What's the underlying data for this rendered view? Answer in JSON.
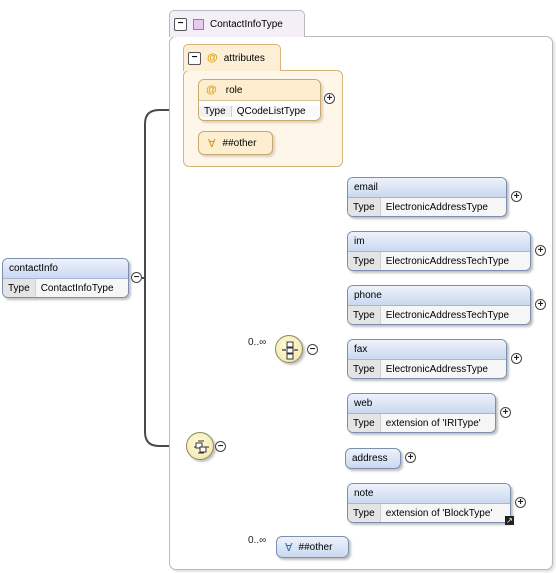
{
  "complex_type": {
    "name": "ContactInfoType"
  },
  "attributes_group": {
    "label": "attributes"
  },
  "attribute_role": {
    "name": "role",
    "type_label": "Type",
    "type_value": "QCodeListType"
  },
  "any_attribute": {
    "label": "##other"
  },
  "root_element": {
    "name": "contactInfo",
    "type_label": "Type",
    "type_value": "ContactInfoType"
  },
  "sequence": {
    "occurrence": "0..∞"
  },
  "elements": [
    {
      "name": "email",
      "type_label": "Type",
      "type_value": "ElectronicAddressType"
    },
    {
      "name": "im",
      "type_label": "Type",
      "type_value": "ElectronicAddressTechType"
    },
    {
      "name": "phone",
      "type_label": "Type",
      "type_value": "ElectronicAddressTechType"
    },
    {
      "name": "fax",
      "type_label": "Type",
      "type_value": "ElectronicAddressType"
    },
    {
      "name": "web",
      "type_label": "Type",
      "type_value": "extension of 'IRIType'"
    },
    {
      "name": "address"
    },
    {
      "name": "note",
      "type_label": "Type",
      "type_value": "extension of 'BlockType'"
    }
  ],
  "any_element": {
    "label": "##other",
    "occurrence": "0..∞"
  },
  "icons": {
    "expand": "+",
    "collapse": "−",
    "at": "@",
    "any": "∀"
  }
}
